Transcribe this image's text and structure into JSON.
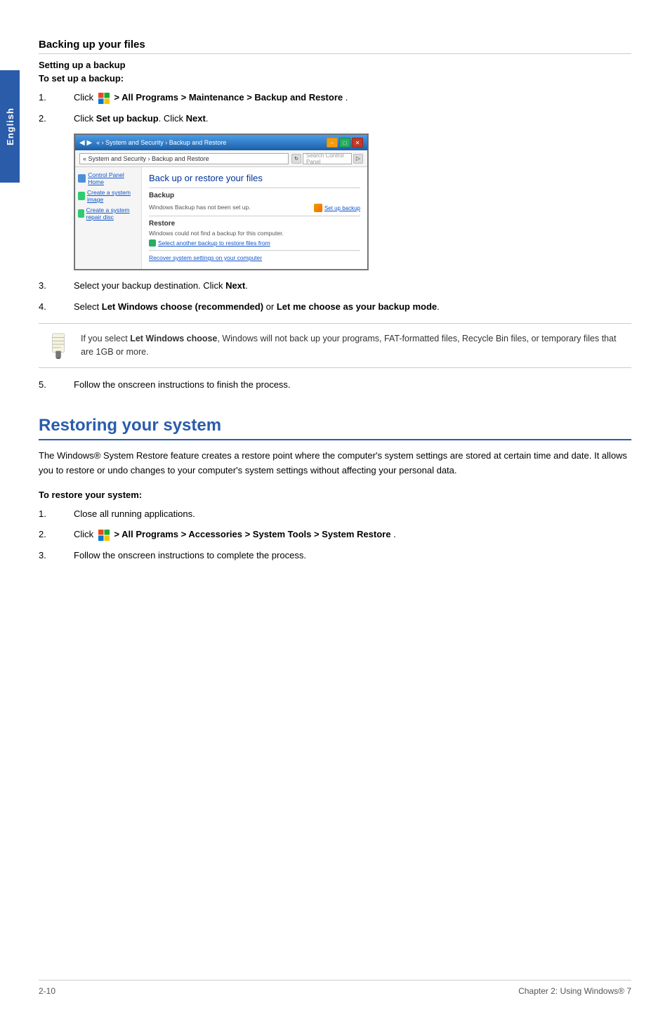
{
  "sidebar": {
    "label": "English"
  },
  "page": {
    "section1_title": "Backing up your files",
    "subsection_title": "Setting up a backup",
    "to_set_up_label": "To set up a backup:",
    "steps": [
      {
        "num": "1.",
        "text_before": "Click",
        "text_middle": " > All Programs > Maintenance > Backup and Restore",
        "bold_parts": [
          " > All Programs > Maintenance > Backup and Restore"
        ]
      },
      {
        "num": "2.",
        "text": "Click Set up backup. Click Next."
      },
      {
        "num": "3.",
        "text": "Select your backup destination. Click Next."
      },
      {
        "num": "4.",
        "text_before": "Select ",
        "bold1": "Let Windows choose (recommended)",
        "text_between": " or ",
        "bold2": "Let me choose as your backup mode",
        "text_after": "."
      },
      {
        "num": "5.",
        "text": "Follow the onscreen instructions to finish the process."
      }
    ],
    "note_text": "If you select Let Windows choose, Windows will not back up your programs, FAT-formatted files, Recycle Bin files, or temporary files that are 1GB or more.",
    "note_bold": "Let Windows choose",
    "restore_section_title": "Restoring your system",
    "restore_description": "The Windows® System Restore feature creates a restore point where the computer's system settings are stored at certain time and date. It allows you to restore or undo changes to your computer's system settings without affecting your personal data.",
    "to_restore_label": "To restore your system:",
    "restore_steps": [
      {
        "num": "1.",
        "text": "Close all running applications."
      },
      {
        "num": "2.",
        "text_before": "Click",
        "text_after": " > All Programs > Accessories > System Tools > System Restore"
      },
      {
        "num": "3.",
        "text": "Follow the onscreen instructions to complete the process."
      }
    ]
  },
  "screenshot": {
    "title": "Back up or restore your files",
    "address": "« System and Security › Backup and Restore",
    "search_placeholder": "Search Control Panel",
    "sidebar_items": [
      "Control Panel Home",
      "Create a system image",
      "Create a system repair disc"
    ],
    "backup_header": "Backup",
    "backup_text": "Windows Backup has not been set up.",
    "backup_action": "Set up backup",
    "restore_header": "Restore",
    "restore_text": "Windows could not find a backup for this computer.",
    "restore_link": "Select another backup to restore files from",
    "recover_link": "Recover system settings on your computer"
  },
  "footer": {
    "left": "2-10",
    "right": "Chapter 2: Using Windows® 7"
  }
}
